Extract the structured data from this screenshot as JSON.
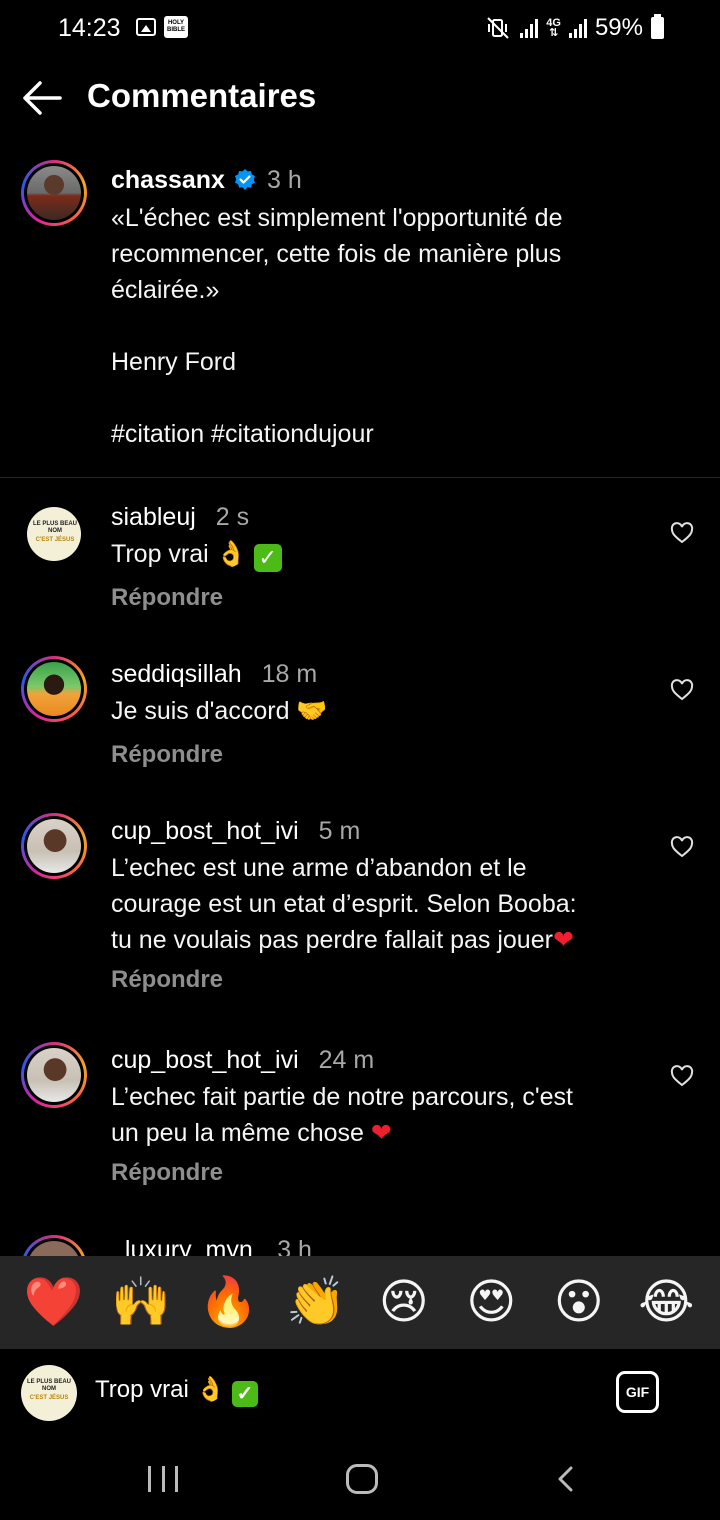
{
  "status_bar": {
    "time": "14:23",
    "bible_icon_text": "HOLY BIBLE",
    "network": "4G",
    "battery": "59%"
  },
  "header": {
    "title": "Commentaires"
  },
  "post": {
    "username": "chassanx",
    "time": "3 h",
    "lines": [
      "«L'échec est simplement l'opportunité de",
      "recommencer, cette fois de manière plus",
      "éclairée.»",
      "",
      "Henry Ford",
      "",
      "#citation #citationdujour"
    ]
  },
  "comments": [
    {
      "username": "siableuj",
      "time": "2 s",
      "text": "Trop vrai 👌",
      "reply_label": "Répondre"
    },
    {
      "username": "seddiqsillah",
      "time": "18 m",
      "text": "Je suis d'accord 🤝",
      "reply_label": "Répondre"
    },
    {
      "username": "cup_bost_hot_ivi",
      "time": "5 m",
      "text_lines": [
        "L’echec est une arme d’abandon et le",
        "courage est un etat d’esprit. Selon Booba:",
        "tu ne voulais pas perdre fallait pas jouer"
      ],
      "reply_label": "Répondre"
    },
    {
      "username": "cup_bost_hot_ivi",
      "time": "24 m",
      "text_lines": [
        "L’echec fait partie de notre parcours, c'est",
        "un peu la même chose"
      ],
      "reply_label": "Répondre"
    },
    {
      "username": "_luxury_myn",
      "time": "3 h"
    }
  ],
  "emoji_bar": [
    "❤️",
    "🙌",
    "🔥",
    "👏",
    "😢",
    "😍",
    "😮",
    "😂"
  ],
  "input": {
    "value": "Trop vrai 👌",
    "gif_label": "GIF"
  },
  "avatar_text": {
    "line1": "LE PLUS BEAU NOM",
    "line2": "C'EST JÉSUS"
  },
  "colors": {
    "background": "#000000",
    "secondary_text": "#a8a8a8",
    "reply_text": "#8e8e8e",
    "verified": "#0095f6",
    "emoji_bar_bg": "#262626"
  }
}
